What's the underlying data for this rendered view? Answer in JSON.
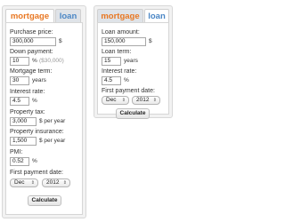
{
  "left": {
    "tabs": {
      "mortgage": "mortgage",
      "loan": "loan"
    },
    "purchase_price": {
      "label": "Purchase price:",
      "value": "300,000",
      "suffix": "$"
    },
    "down_payment": {
      "label": "Down payment:",
      "value": "10",
      "suffix": "%",
      "hint": "($30,000)"
    },
    "mortgage_term": {
      "label": "Mortgage term:",
      "value": "30",
      "suffix": "years"
    },
    "interest_rate": {
      "label": "Interest rate:",
      "value": "4.5",
      "suffix": "%"
    },
    "property_tax": {
      "label": "Property tax:",
      "value": "3,000",
      "suffix": "$ per year"
    },
    "property_insurance": {
      "label": "Property insurance:",
      "value": "1,500",
      "suffix": "$ per year"
    },
    "pmi": {
      "label": "PMI:",
      "value": "0.52",
      "suffix": "%"
    },
    "first_payment": {
      "label": "First payment date:",
      "month": "Dec",
      "year": "2012"
    },
    "calculate": "Calculate"
  },
  "right": {
    "tabs": {
      "mortgage": "mortgage",
      "loan": "loan"
    },
    "loan_amount": {
      "label": "Loan amount:",
      "value": "150,000",
      "suffix": "$"
    },
    "loan_term": {
      "label": "Loan term:",
      "value": "15",
      "suffix": "years"
    },
    "interest_rate": {
      "label": "Interest rate:",
      "value": "4.5",
      "suffix": "%"
    },
    "first_payment": {
      "label": "First payment date:",
      "month": "Dec",
      "year": "2012"
    },
    "calculate": "Calculate"
  },
  "icons": {
    "select_arrow": "up-down-arrows-icon"
  },
  "colors": {
    "active_tab_text": "#e87722",
    "inactive_tab_text": "#4a86c5",
    "panel_bg": "#f2f2f2"
  }
}
